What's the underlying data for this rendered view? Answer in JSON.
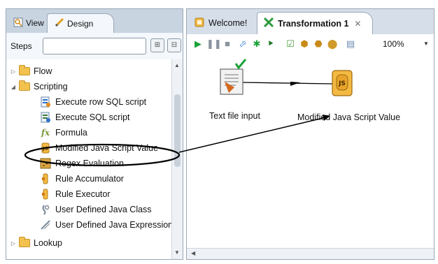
{
  "left_panel": {
    "tabs": {
      "view": "View",
      "design": "Design"
    },
    "steps_label": "Steps",
    "search": {
      "value": "",
      "placeholder": ""
    },
    "tree": [
      {
        "label": "Flow",
        "type": "folder",
        "expanded": false
      },
      {
        "label": "Scripting",
        "type": "folder",
        "expanded": true
      },
      {
        "label": "Execute row SQL script",
        "type": "step",
        "icon": "sql-row-icon"
      },
      {
        "label": "Execute SQL script",
        "type": "step",
        "icon": "sql-script-icon"
      },
      {
        "label": "Formula",
        "type": "step",
        "icon": "formula-icon"
      },
      {
        "label": "Modified Java Script Value",
        "type": "step",
        "icon": "javascript-icon",
        "highlighted": true
      },
      {
        "label": "Regex Evaluation",
        "type": "step",
        "icon": "regex-icon"
      },
      {
        "label": "Rule Accumulator",
        "type": "step",
        "icon": "rule-accumulator-icon"
      },
      {
        "label": "Rule Executor",
        "type": "step",
        "icon": "rule-executor-icon"
      },
      {
        "label": "User Defined Java Class",
        "type": "step",
        "icon": "java-class-icon"
      },
      {
        "label": "User Defined Java Expression",
        "type": "step",
        "icon": "java-expression-icon"
      },
      {
        "label": "Lookup",
        "type": "folder",
        "expanded": false
      }
    ]
  },
  "right_panel": {
    "tabs": {
      "welcome": "Welcome!",
      "transformation": "Transformation 1"
    },
    "toolbar": {
      "zoom": "100%",
      "buttons": [
        "run-icon",
        "pause-icon",
        "stop-icon",
        "preview-icon",
        "debug-icon",
        "replay-icon",
        "verify-icon",
        "impact-icon",
        "sql-icon",
        "explore-db-icon",
        "show-results-icon"
      ]
    },
    "canvas": {
      "nodes": [
        {
          "label": "Text file input",
          "icon": "text-file-input-icon"
        },
        {
          "label": "Modified Java Script Value",
          "icon": "javascript-icon",
          "badge": "JS"
        }
      ]
    }
  },
  "colors": {
    "panel_bg": "#d6dfe9",
    "folder": "#f2c14e",
    "run_green": "#1aa33a",
    "hop_line": "#000000"
  }
}
